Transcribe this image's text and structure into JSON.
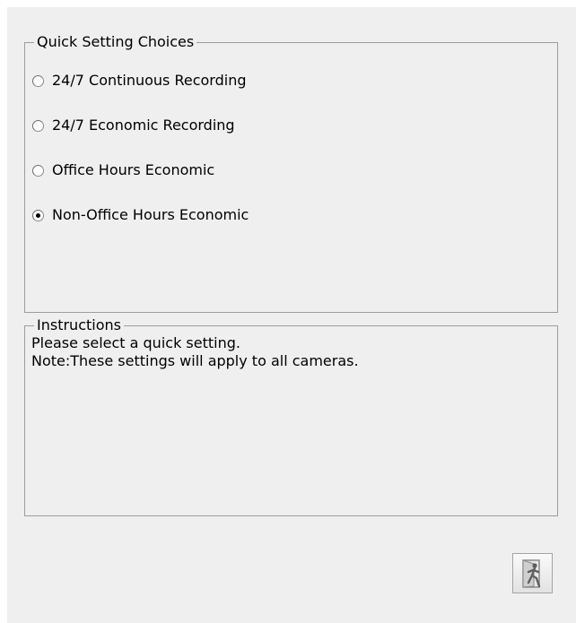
{
  "choices": {
    "title": "Quick Setting Choices",
    "options": [
      {
        "label": "24/7 Continuous Recording",
        "selected": false
      },
      {
        "label": "24/7 Economic Recording",
        "selected": false
      },
      {
        "label": "Office Hours Economic",
        "selected": false
      },
      {
        "label": "Non-Office Hours Economic",
        "selected": true
      }
    ]
  },
  "instructions": {
    "title": "Instructions",
    "line1": "Please select a quick setting.",
    "line2": "Note:These settings will apply to all cameras."
  },
  "exit_button": {
    "icon": "exit-door-icon"
  }
}
